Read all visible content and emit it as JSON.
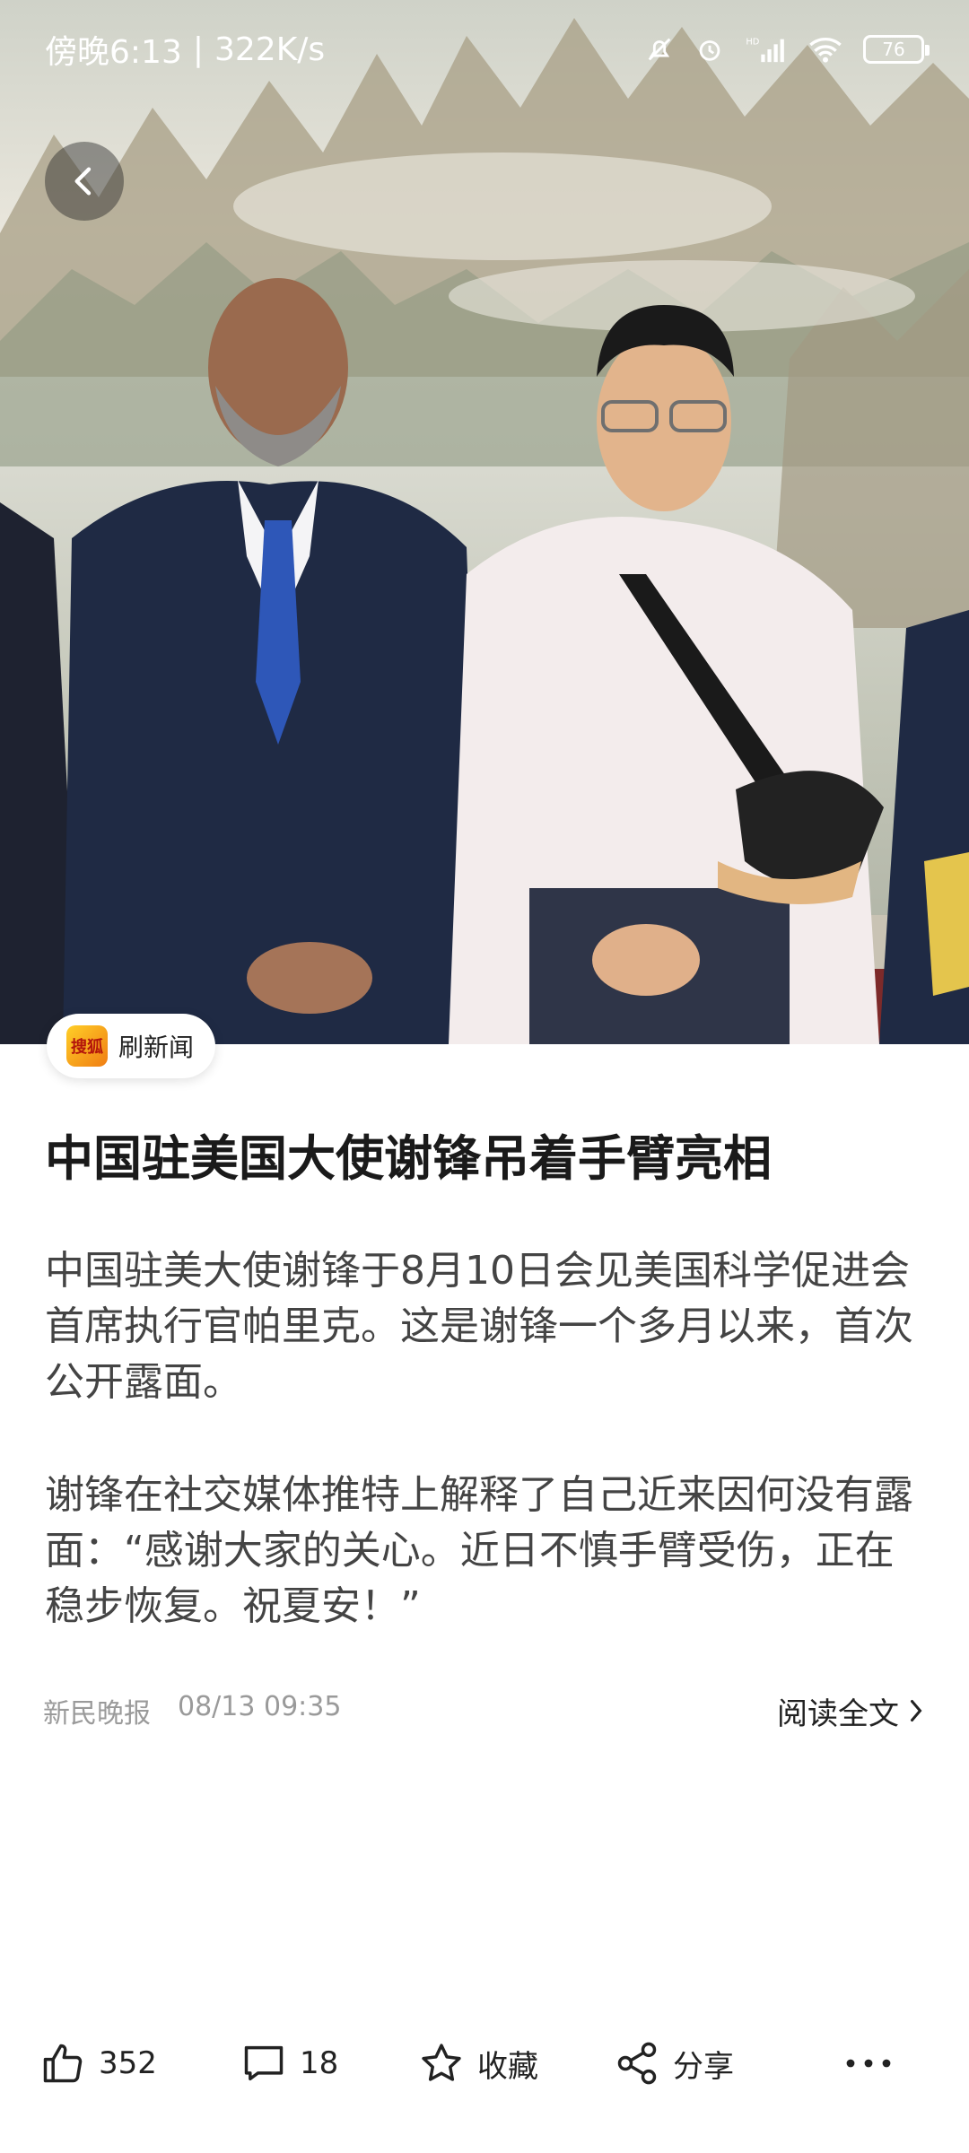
{
  "status_bar": {
    "time": "傍晚6:13",
    "speed": "322K/s",
    "battery": "76",
    "icons": [
      "mute-icon",
      "alarm-icon",
      "hd-signal-icon",
      "wifi-icon",
      "battery-icon"
    ]
  },
  "nav": {
    "back_icon": "chevron-left-icon"
  },
  "source": {
    "logo_text": "搜狐",
    "label": "刷新闻"
  },
  "article": {
    "title": "中国驻美国大使谢锋吊着手臂亮相",
    "paragraphs": [
      "中国驻美大使谢锋于8月10日会见美国科学促进会首席执行官帕里克。这是谢锋一个多月以来，首次公开露面。",
      "谢锋在社交媒体推特上解释了自己近来因何没有露面：“感谢大家的关心。近日不慎手臂受伤，正在稳步恢复。祝夏安！”"
    ],
    "publisher": "新民晚报",
    "datetime": "08/13 09:35",
    "read_full": "阅读全文"
  },
  "actions": {
    "like_count": "352",
    "comment_count": "18",
    "favorite_label": "收藏",
    "share_label": "分享"
  }
}
